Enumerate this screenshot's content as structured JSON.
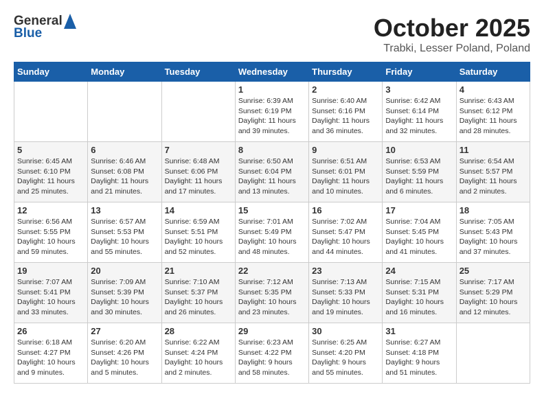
{
  "logo": {
    "general": "General",
    "blue": "Blue"
  },
  "header": {
    "month": "October 2025",
    "location": "Trabki, Lesser Poland, Poland"
  },
  "weekdays": [
    "Sunday",
    "Monday",
    "Tuesday",
    "Wednesday",
    "Thursday",
    "Friday",
    "Saturday"
  ],
  "weeks": [
    [
      {
        "day": "",
        "content": ""
      },
      {
        "day": "",
        "content": ""
      },
      {
        "day": "",
        "content": ""
      },
      {
        "day": "1",
        "content": "Sunrise: 6:39 AM\nSunset: 6:19 PM\nDaylight: 11 hours\nand 39 minutes."
      },
      {
        "day": "2",
        "content": "Sunrise: 6:40 AM\nSunset: 6:16 PM\nDaylight: 11 hours\nand 36 minutes."
      },
      {
        "day": "3",
        "content": "Sunrise: 6:42 AM\nSunset: 6:14 PM\nDaylight: 11 hours\nand 32 minutes."
      },
      {
        "day": "4",
        "content": "Sunrise: 6:43 AM\nSunset: 6:12 PM\nDaylight: 11 hours\nand 28 minutes."
      }
    ],
    [
      {
        "day": "5",
        "content": "Sunrise: 6:45 AM\nSunset: 6:10 PM\nDaylight: 11 hours\nand 25 minutes."
      },
      {
        "day": "6",
        "content": "Sunrise: 6:46 AM\nSunset: 6:08 PM\nDaylight: 11 hours\nand 21 minutes."
      },
      {
        "day": "7",
        "content": "Sunrise: 6:48 AM\nSunset: 6:06 PM\nDaylight: 11 hours\nand 17 minutes."
      },
      {
        "day": "8",
        "content": "Sunrise: 6:50 AM\nSunset: 6:04 PM\nDaylight: 11 hours\nand 13 minutes."
      },
      {
        "day": "9",
        "content": "Sunrise: 6:51 AM\nSunset: 6:01 PM\nDaylight: 11 hours\nand 10 minutes."
      },
      {
        "day": "10",
        "content": "Sunrise: 6:53 AM\nSunset: 5:59 PM\nDaylight: 11 hours\nand 6 minutes."
      },
      {
        "day": "11",
        "content": "Sunrise: 6:54 AM\nSunset: 5:57 PM\nDaylight: 11 hours\nand 2 minutes."
      }
    ],
    [
      {
        "day": "12",
        "content": "Sunrise: 6:56 AM\nSunset: 5:55 PM\nDaylight: 10 hours\nand 59 minutes."
      },
      {
        "day": "13",
        "content": "Sunrise: 6:57 AM\nSunset: 5:53 PM\nDaylight: 10 hours\nand 55 minutes."
      },
      {
        "day": "14",
        "content": "Sunrise: 6:59 AM\nSunset: 5:51 PM\nDaylight: 10 hours\nand 52 minutes."
      },
      {
        "day": "15",
        "content": "Sunrise: 7:01 AM\nSunset: 5:49 PM\nDaylight: 10 hours\nand 48 minutes."
      },
      {
        "day": "16",
        "content": "Sunrise: 7:02 AM\nSunset: 5:47 PM\nDaylight: 10 hours\nand 44 minutes."
      },
      {
        "day": "17",
        "content": "Sunrise: 7:04 AM\nSunset: 5:45 PM\nDaylight: 10 hours\nand 41 minutes."
      },
      {
        "day": "18",
        "content": "Sunrise: 7:05 AM\nSunset: 5:43 PM\nDaylight: 10 hours\nand 37 minutes."
      }
    ],
    [
      {
        "day": "19",
        "content": "Sunrise: 7:07 AM\nSunset: 5:41 PM\nDaylight: 10 hours\nand 33 minutes."
      },
      {
        "day": "20",
        "content": "Sunrise: 7:09 AM\nSunset: 5:39 PM\nDaylight: 10 hours\nand 30 minutes."
      },
      {
        "day": "21",
        "content": "Sunrise: 7:10 AM\nSunset: 5:37 PM\nDaylight: 10 hours\nand 26 minutes."
      },
      {
        "day": "22",
        "content": "Sunrise: 7:12 AM\nSunset: 5:35 PM\nDaylight: 10 hours\nand 23 minutes."
      },
      {
        "day": "23",
        "content": "Sunrise: 7:13 AM\nSunset: 5:33 PM\nDaylight: 10 hours\nand 19 minutes."
      },
      {
        "day": "24",
        "content": "Sunrise: 7:15 AM\nSunset: 5:31 PM\nDaylight: 10 hours\nand 16 minutes."
      },
      {
        "day": "25",
        "content": "Sunrise: 7:17 AM\nSunset: 5:29 PM\nDaylight: 10 hours\nand 12 minutes."
      }
    ],
    [
      {
        "day": "26",
        "content": "Sunrise: 6:18 AM\nSunset: 4:27 PM\nDaylight: 10 hours\nand 9 minutes."
      },
      {
        "day": "27",
        "content": "Sunrise: 6:20 AM\nSunset: 4:26 PM\nDaylight: 10 hours\nand 5 minutes."
      },
      {
        "day": "28",
        "content": "Sunrise: 6:22 AM\nSunset: 4:24 PM\nDaylight: 10 hours\nand 2 minutes."
      },
      {
        "day": "29",
        "content": "Sunrise: 6:23 AM\nSunset: 4:22 PM\nDaylight: 9 hours\nand 58 minutes."
      },
      {
        "day": "30",
        "content": "Sunrise: 6:25 AM\nSunset: 4:20 PM\nDaylight: 9 hours\nand 55 minutes."
      },
      {
        "day": "31",
        "content": "Sunrise: 6:27 AM\nSunset: 4:18 PM\nDaylight: 9 hours\nand 51 minutes."
      },
      {
        "day": "",
        "content": ""
      }
    ]
  ]
}
